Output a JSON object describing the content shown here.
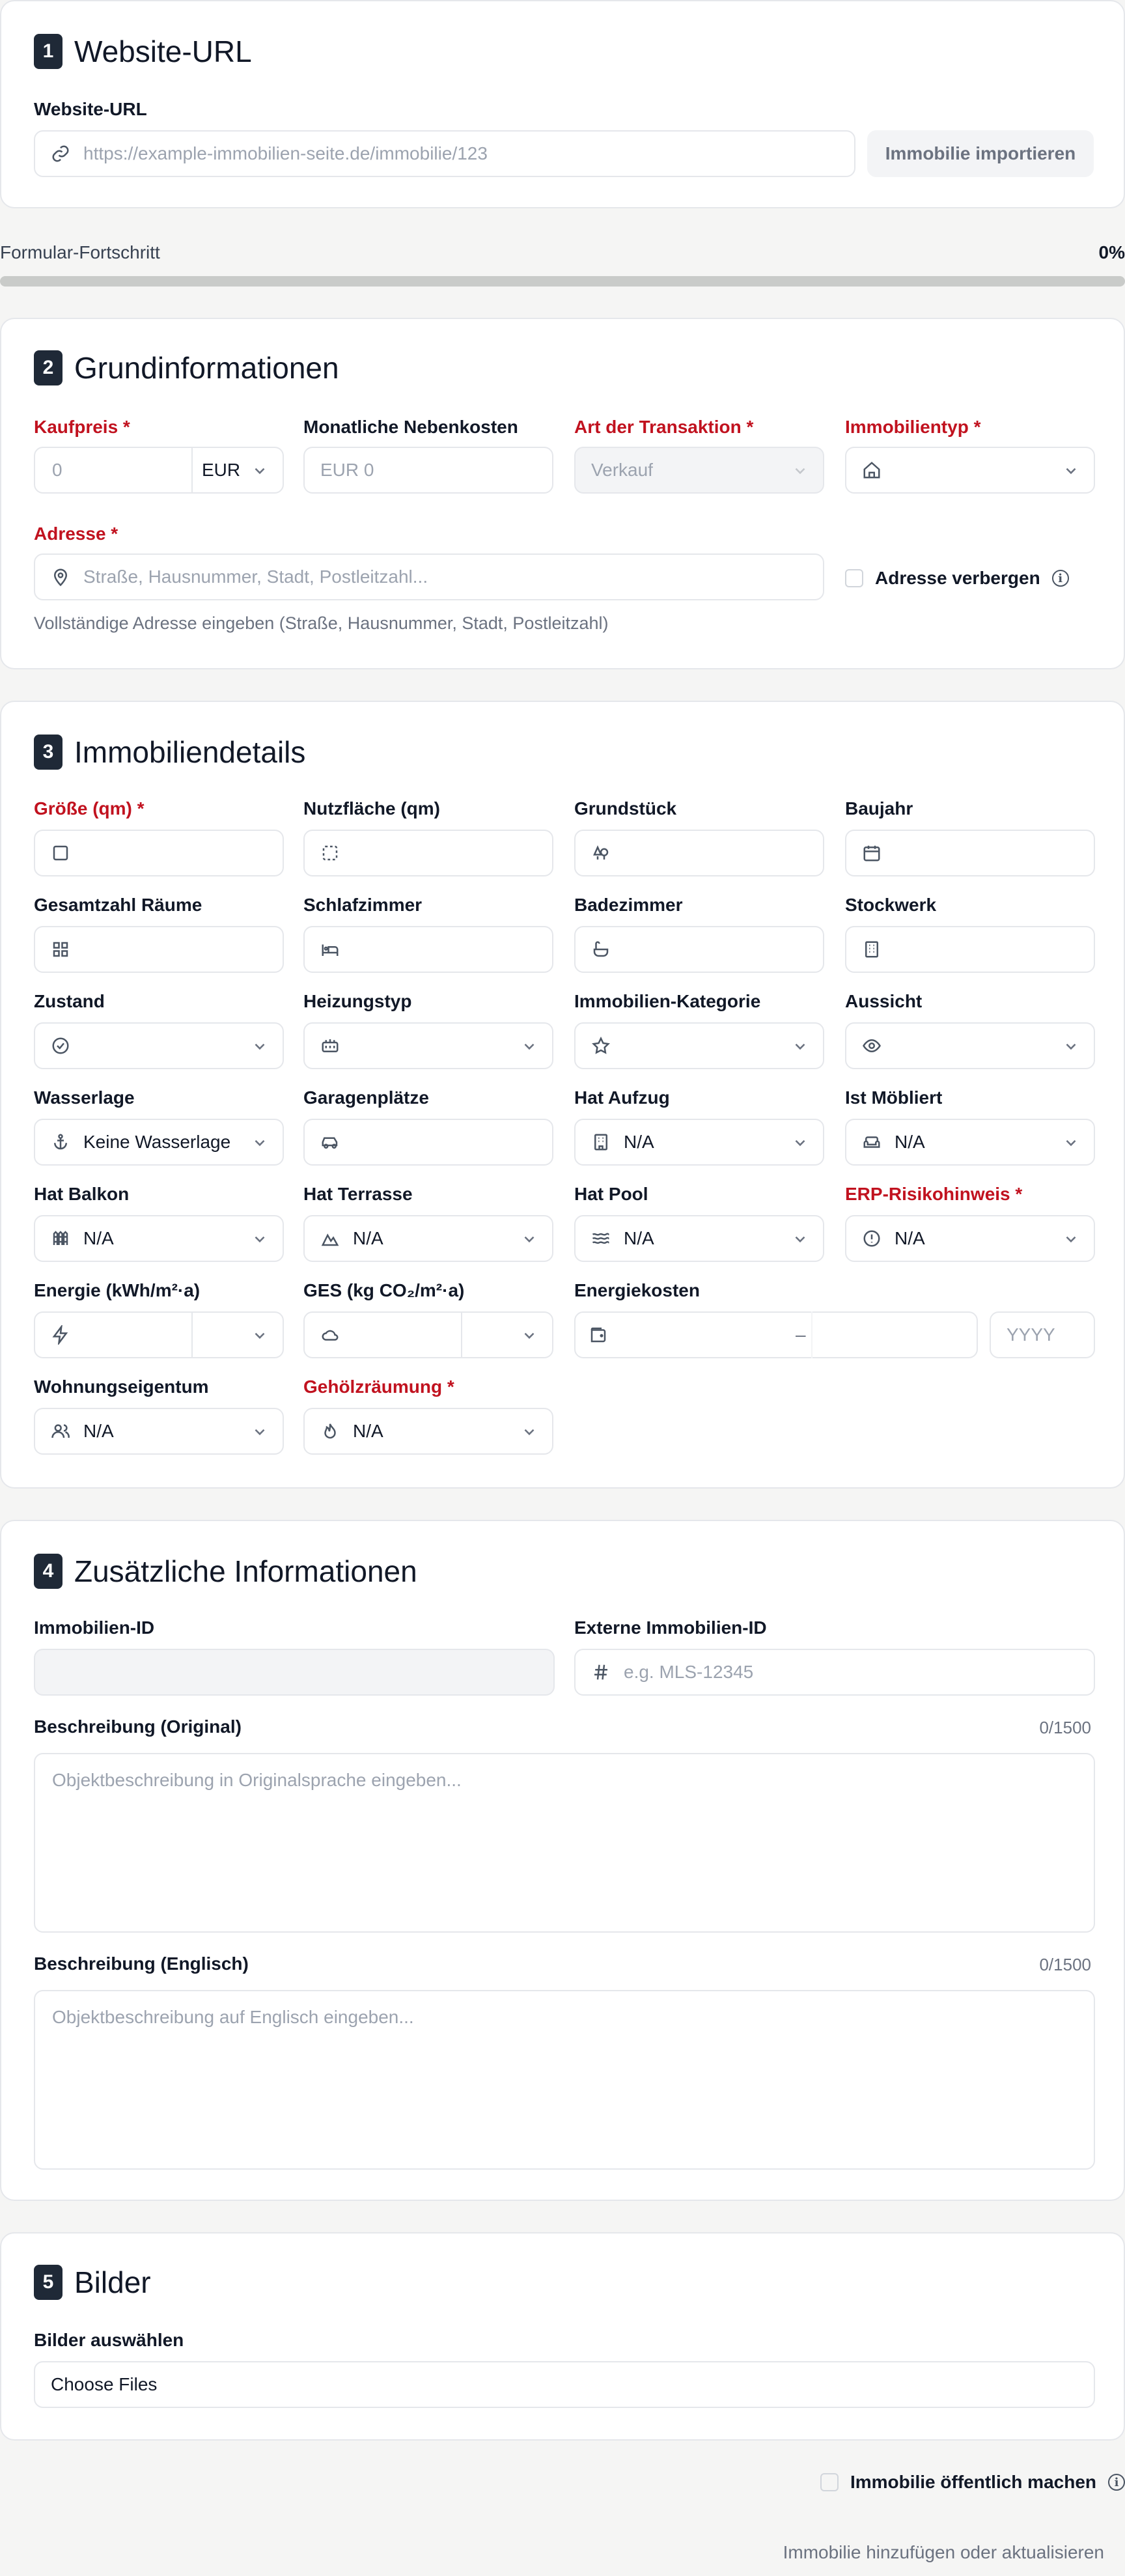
{
  "website": {
    "step": "1",
    "title": "Website-URL",
    "url_label": "Website-URL",
    "url_placeholder": "https://example-immobilien-seite.de/immobilie/123",
    "import_button": "Immobilie importieren"
  },
  "progress": {
    "label": "Formular-Fortschritt",
    "value_text": "0%",
    "value": 0
  },
  "grund": {
    "step": "2",
    "title": "Grundinformationen",
    "price_label": "Kaufpreis *",
    "price_placeholder": "0",
    "currency": "EUR",
    "nebenkosten_label": "Monatliche Nebenkosten",
    "nebenkosten_placeholder": "EUR 0",
    "transaktion_label": "Art der Transaktion *",
    "transaktion_value": "Verkauf",
    "typ_label": "Immobilientyp *",
    "adresse_label": "Adresse *",
    "adresse_placeholder": "Straße, Hausnummer, Stadt, Postleitzahl...",
    "hide_address_label": "Adresse verbergen",
    "adresse_hint": "Vollständige Adresse eingeben (Straße, Hausnummer, Stadt, Postleitzahl)"
  },
  "details": {
    "step": "3",
    "title": "Immobiliendetails",
    "groesse": "Größe (qm) *",
    "nutzflaeche": "Nutzfläche (qm)",
    "grundstueck": "Grundstück",
    "baujahr": "Baujahr",
    "raeume": "Gesamtzahl Räume",
    "schlafzimmer": "Schlafzimmer",
    "badezimmer": "Badezimmer",
    "stockwerk": "Stockwerk",
    "zustand": "Zustand",
    "heizung": "Heizungstyp",
    "kategorie": "Immobilien-Kategorie",
    "aussicht": "Aussicht",
    "wasserlage": "Wasserlage",
    "wasserlage_value": "Keine Wasserlage",
    "garage": "Garagenplätze",
    "aufzug": "Hat Aufzug",
    "aufzug_value": "N/A",
    "moebliert": "Ist Möbliert",
    "moebliert_value": "N/A",
    "balkon": "Hat Balkon",
    "balkon_value": "N/A",
    "terrasse": "Hat Terrasse",
    "terrasse_value": "N/A",
    "pool": "Hat Pool",
    "pool_value": "N/A",
    "erp": "ERP-Risikohinweis *",
    "erp_value": "N/A",
    "energie": "Energie (kWh/m²·a)",
    "ges": "GES (kg CO₂/m²·a)",
    "energiekosten": "Energiekosten",
    "energiekosten_sep": "–",
    "energiekosten_year_placeholder": "YYYY",
    "eigentum": "Wohnungseigentum",
    "eigentum_value": "N/A",
    "gehoelz": "Gehölzräumung *",
    "gehoelz_value": "N/A"
  },
  "zusatz": {
    "step": "4",
    "title": "Zusätzliche Informationen",
    "id_label": "Immobilien-ID",
    "ext_id_label": "Externe Immobilien-ID",
    "ext_id_placeholder": "e.g. MLS-12345",
    "desc_orig_label": "Beschreibung (Original)",
    "desc_orig_counter": "0/1500",
    "desc_orig_placeholder": "Objektbeschreibung in Originalsprache eingeben...",
    "desc_en_label": "Beschreibung (Englisch)",
    "desc_en_counter": "0/1500",
    "desc_en_placeholder": "Objektbeschreibung auf Englisch eingeben..."
  },
  "bilder": {
    "step": "5",
    "title": "Bilder",
    "select_label": "Bilder auswählen",
    "choose_files": "Choose Files"
  },
  "footer": {
    "public_label": "Immobilie öffentlich machen",
    "submit": "Immobilie hinzufügen oder aktualisieren"
  },
  "colors": {
    "required": "#c1121f",
    "badge": "#1f2937",
    "border": "#e5e7eb",
    "background": "#f5f5f4"
  }
}
